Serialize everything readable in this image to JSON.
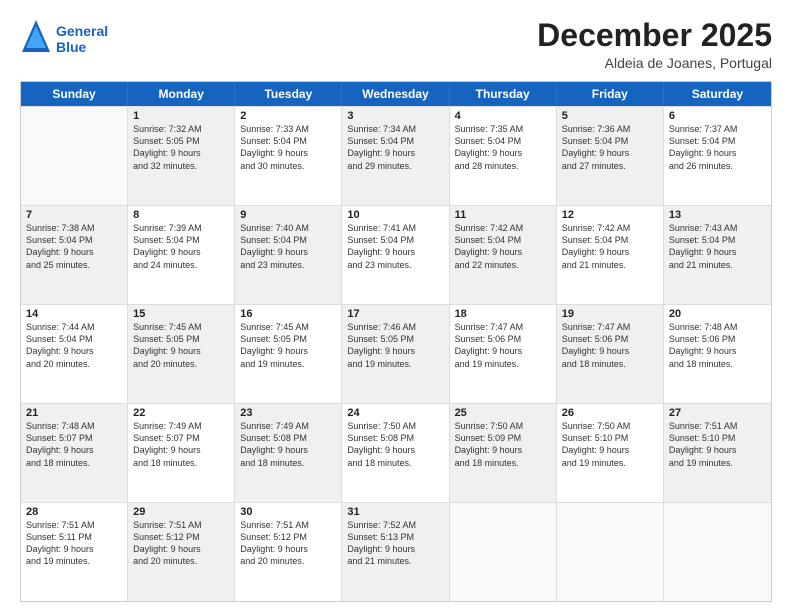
{
  "logo": {
    "line1": "General",
    "line2": "Blue"
  },
  "title": "December 2025",
  "location": "Aldeia de Joanes, Portugal",
  "headers": [
    "Sunday",
    "Monday",
    "Tuesday",
    "Wednesday",
    "Thursday",
    "Friday",
    "Saturday"
  ],
  "rows": [
    [
      {
        "day": "",
        "info": "",
        "empty": true
      },
      {
        "day": "1",
        "info": "Sunrise: 7:32 AM\nSunset: 5:05 PM\nDaylight: 9 hours\nand 32 minutes.",
        "shaded": true
      },
      {
        "day": "2",
        "info": "Sunrise: 7:33 AM\nSunset: 5:04 PM\nDaylight: 9 hours\nand 30 minutes."
      },
      {
        "day": "3",
        "info": "Sunrise: 7:34 AM\nSunset: 5:04 PM\nDaylight: 9 hours\nand 29 minutes.",
        "shaded": true
      },
      {
        "day": "4",
        "info": "Sunrise: 7:35 AM\nSunset: 5:04 PM\nDaylight: 9 hours\nand 28 minutes."
      },
      {
        "day": "5",
        "info": "Sunrise: 7:36 AM\nSunset: 5:04 PM\nDaylight: 9 hours\nand 27 minutes.",
        "shaded": true
      },
      {
        "day": "6",
        "info": "Sunrise: 7:37 AM\nSunset: 5:04 PM\nDaylight: 9 hours\nand 26 minutes."
      }
    ],
    [
      {
        "day": "7",
        "info": "Sunrise: 7:38 AM\nSunset: 5:04 PM\nDaylight: 9 hours\nand 25 minutes.",
        "shaded": true
      },
      {
        "day": "8",
        "info": "Sunrise: 7:39 AM\nSunset: 5:04 PM\nDaylight: 9 hours\nand 24 minutes."
      },
      {
        "day": "9",
        "info": "Sunrise: 7:40 AM\nSunset: 5:04 PM\nDaylight: 9 hours\nand 23 minutes.",
        "shaded": true
      },
      {
        "day": "10",
        "info": "Sunrise: 7:41 AM\nSunset: 5:04 PM\nDaylight: 9 hours\nand 23 minutes."
      },
      {
        "day": "11",
        "info": "Sunrise: 7:42 AM\nSunset: 5:04 PM\nDaylight: 9 hours\nand 22 minutes.",
        "shaded": true
      },
      {
        "day": "12",
        "info": "Sunrise: 7:42 AM\nSunset: 5:04 PM\nDaylight: 9 hours\nand 21 minutes."
      },
      {
        "day": "13",
        "info": "Sunrise: 7:43 AM\nSunset: 5:04 PM\nDaylight: 9 hours\nand 21 minutes.",
        "shaded": true
      }
    ],
    [
      {
        "day": "14",
        "info": "Sunrise: 7:44 AM\nSunset: 5:04 PM\nDaylight: 9 hours\nand 20 minutes."
      },
      {
        "day": "15",
        "info": "Sunrise: 7:45 AM\nSunset: 5:05 PM\nDaylight: 9 hours\nand 20 minutes.",
        "shaded": true
      },
      {
        "day": "16",
        "info": "Sunrise: 7:45 AM\nSunset: 5:05 PM\nDaylight: 9 hours\nand 19 minutes."
      },
      {
        "day": "17",
        "info": "Sunrise: 7:46 AM\nSunset: 5:05 PM\nDaylight: 9 hours\nand 19 minutes.",
        "shaded": true
      },
      {
        "day": "18",
        "info": "Sunrise: 7:47 AM\nSunset: 5:06 PM\nDaylight: 9 hours\nand 19 minutes."
      },
      {
        "day": "19",
        "info": "Sunrise: 7:47 AM\nSunset: 5:06 PM\nDaylight: 9 hours\nand 18 minutes.",
        "shaded": true
      },
      {
        "day": "20",
        "info": "Sunrise: 7:48 AM\nSunset: 5:06 PM\nDaylight: 9 hours\nand 18 minutes."
      }
    ],
    [
      {
        "day": "21",
        "info": "Sunrise: 7:48 AM\nSunset: 5:07 PM\nDaylight: 9 hours\nand 18 minutes.",
        "shaded": true
      },
      {
        "day": "22",
        "info": "Sunrise: 7:49 AM\nSunset: 5:07 PM\nDaylight: 9 hours\nand 18 minutes."
      },
      {
        "day": "23",
        "info": "Sunrise: 7:49 AM\nSunset: 5:08 PM\nDaylight: 9 hours\nand 18 minutes.",
        "shaded": true
      },
      {
        "day": "24",
        "info": "Sunrise: 7:50 AM\nSunset: 5:08 PM\nDaylight: 9 hours\nand 18 minutes."
      },
      {
        "day": "25",
        "info": "Sunrise: 7:50 AM\nSunset: 5:09 PM\nDaylight: 9 hours\nand 18 minutes.",
        "shaded": true
      },
      {
        "day": "26",
        "info": "Sunrise: 7:50 AM\nSunset: 5:10 PM\nDaylight: 9 hours\nand 19 minutes."
      },
      {
        "day": "27",
        "info": "Sunrise: 7:51 AM\nSunset: 5:10 PM\nDaylight: 9 hours\nand 19 minutes.",
        "shaded": true
      }
    ],
    [
      {
        "day": "28",
        "info": "Sunrise: 7:51 AM\nSunset: 5:11 PM\nDaylight: 9 hours\nand 19 minutes."
      },
      {
        "day": "29",
        "info": "Sunrise: 7:51 AM\nSunset: 5:12 PM\nDaylight: 9 hours\nand 20 minutes.",
        "shaded": true
      },
      {
        "day": "30",
        "info": "Sunrise: 7:51 AM\nSunset: 5:12 PM\nDaylight: 9 hours\nand 20 minutes."
      },
      {
        "day": "31",
        "info": "Sunrise: 7:52 AM\nSunset: 5:13 PM\nDaylight: 9 hours\nand 21 minutes.",
        "shaded": true
      },
      {
        "day": "",
        "info": "",
        "empty": true
      },
      {
        "day": "",
        "info": "",
        "empty": true
      },
      {
        "day": "",
        "info": "",
        "empty": true
      }
    ]
  ]
}
